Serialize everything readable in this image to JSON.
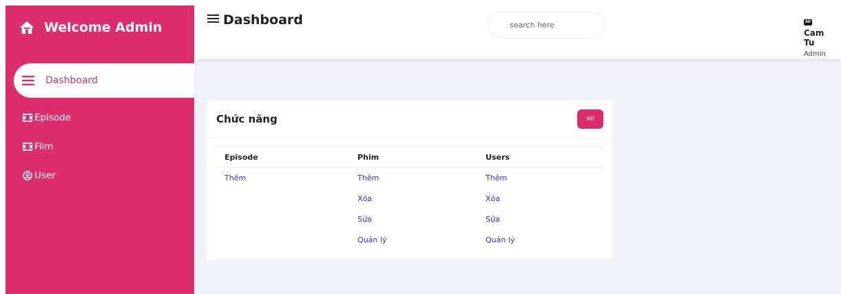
{
  "colors": {
    "accent": "#dd2f6e",
    "link": "#3b2fd0",
    "main_bg": "#f0f2f7"
  },
  "sidebar": {
    "brand": {
      "icon": "home-icon",
      "title": "Welcome Admin"
    },
    "items": [
      {
        "icon": "menu-icon",
        "label": "Dashboard",
        "active": true
      },
      {
        "icon": "film-icon",
        "label": "Episode"
      },
      {
        "icon": "film-icon",
        "label": "Film"
      },
      {
        "icon": "user-circle-icon",
        "label": "User"
      }
    ]
  },
  "header": {
    "title": "Dashboard",
    "search": {
      "placeholder": "search here"
    },
    "user": {
      "badge": "AD",
      "name": "Cam Tu",
      "role": "Admin"
    }
  },
  "card": {
    "title": "Chức năng",
    "button": "All",
    "columns": [
      "Episode",
      "Phim",
      "Users"
    ],
    "rows": [
      [
        "Thêm",
        "Thêm",
        "Thêm"
      ],
      [
        "",
        "Xóa",
        "Xóa"
      ],
      [
        "",
        "Sửa",
        "Sửa"
      ],
      [
        "",
        "Quản lý",
        "Quản lý"
      ]
    ]
  }
}
